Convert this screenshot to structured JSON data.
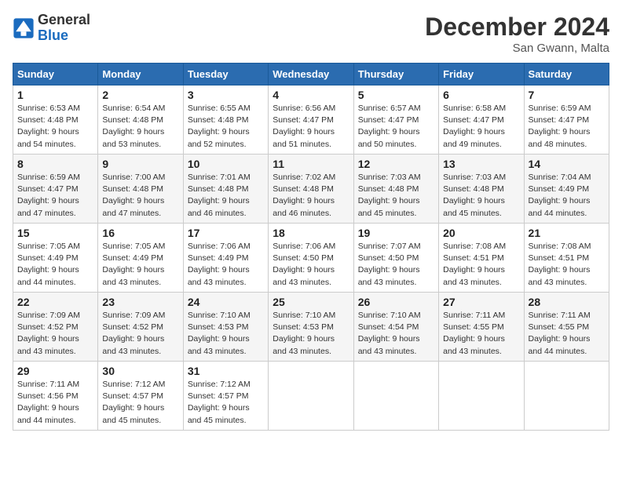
{
  "header": {
    "logo_general": "General",
    "logo_blue": "Blue",
    "month_title": "December 2024",
    "location": "San Gwann, Malta"
  },
  "weekdays": [
    "Sunday",
    "Monday",
    "Tuesday",
    "Wednesday",
    "Thursday",
    "Friday",
    "Saturday"
  ],
  "weeks": [
    [
      {
        "day": 1,
        "sunrise": "6:53 AM",
        "sunset": "4:48 PM",
        "daylight": "9 hours and 54 minutes."
      },
      {
        "day": 2,
        "sunrise": "6:54 AM",
        "sunset": "4:48 PM",
        "daylight": "9 hours and 53 minutes."
      },
      {
        "day": 3,
        "sunrise": "6:55 AM",
        "sunset": "4:48 PM",
        "daylight": "9 hours and 52 minutes."
      },
      {
        "day": 4,
        "sunrise": "6:56 AM",
        "sunset": "4:47 PM",
        "daylight": "9 hours and 51 minutes."
      },
      {
        "day": 5,
        "sunrise": "6:57 AM",
        "sunset": "4:47 PM",
        "daylight": "9 hours and 50 minutes."
      },
      {
        "day": 6,
        "sunrise": "6:58 AM",
        "sunset": "4:47 PM",
        "daylight": "9 hours and 49 minutes."
      },
      {
        "day": 7,
        "sunrise": "6:59 AM",
        "sunset": "4:47 PM",
        "daylight": "9 hours and 48 minutes."
      }
    ],
    [
      {
        "day": 8,
        "sunrise": "6:59 AM",
        "sunset": "4:47 PM",
        "daylight": "9 hours and 47 minutes."
      },
      {
        "day": 9,
        "sunrise": "7:00 AM",
        "sunset": "4:48 PM",
        "daylight": "9 hours and 47 minutes."
      },
      {
        "day": 10,
        "sunrise": "7:01 AM",
        "sunset": "4:48 PM",
        "daylight": "9 hours and 46 minutes."
      },
      {
        "day": 11,
        "sunrise": "7:02 AM",
        "sunset": "4:48 PM",
        "daylight": "9 hours and 46 minutes."
      },
      {
        "day": 12,
        "sunrise": "7:03 AM",
        "sunset": "4:48 PM",
        "daylight": "9 hours and 45 minutes."
      },
      {
        "day": 13,
        "sunrise": "7:03 AM",
        "sunset": "4:48 PM",
        "daylight": "9 hours and 45 minutes."
      },
      {
        "day": 14,
        "sunrise": "7:04 AM",
        "sunset": "4:49 PM",
        "daylight": "9 hours and 44 minutes."
      }
    ],
    [
      {
        "day": 15,
        "sunrise": "7:05 AM",
        "sunset": "4:49 PM",
        "daylight": "9 hours and 44 minutes."
      },
      {
        "day": 16,
        "sunrise": "7:05 AM",
        "sunset": "4:49 PM",
        "daylight": "9 hours and 43 minutes."
      },
      {
        "day": 17,
        "sunrise": "7:06 AM",
        "sunset": "4:49 PM",
        "daylight": "9 hours and 43 minutes."
      },
      {
        "day": 18,
        "sunrise": "7:06 AM",
        "sunset": "4:50 PM",
        "daylight": "9 hours and 43 minutes."
      },
      {
        "day": 19,
        "sunrise": "7:07 AM",
        "sunset": "4:50 PM",
        "daylight": "9 hours and 43 minutes."
      },
      {
        "day": 20,
        "sunrise": "7:08 AM",
        "sunset": "4:51 PM",
        "daylight": "9 hours and 43 minutes."
      },
      {
        "day": 21,
        "sunrise": "7:08 AM",
        "sunset": "4:51 PM",
        "daylight": "9 hours and 43 minutes."
      }
    ],
    [
      {
        "day": 22,
        "sunrise": "7:09 AM",
        "sunset": "4:52 PM",
        "daylight": "9 hours and 43 minutes."
      },
      {
        "day": 23,
        "sunrise": "7:09 AM",
        "sunset": "4:52 PM",
        "daylight": "9 hours and 43 minutes."
      },
      {
        "day": 24,
        "sunrise": "7:10 AM",
        "sunset": "4:53 PM",
        "daylight": "9 hours and 43 minutes."
      },
      {
        "day": 25,
        "sunrise": "7:10 AM",
        "sunset": "4:53 PM",
        "daylight": "9 hours and 43 minutes."
      },
      {
        "day": 26,
        "sunrise": "7:10 AM",
        "sunset": "4:54 PM",
        "daylight": "9 hours and 43 minutes."
      },
      {
        "day": 27,
        "sunrise": "7:11 AM",
        "sunset": "4:55 PM",
        "daylight": "9 hours and 43 minutes."
      },
      {
        "day": 28,
        "sunrise": "7:11 AM",
        "sunset": "4:55 PM",
        "daylight": "9 hours and 44 minutes."
      }
    ],
    [
      {
        "day": 29,
        "sunrise": "7:11 AM",
        "sunset": "4:56 PM",
        "daylight": "9 hours and 44 minutes."
      },
      {
        "day": 30,
        "sunrise": "7:12 AM",
        "sunset": "4:57 PM",
        "daylight": "9 hours and 45 minutes."
      },
      {
        "day": 31,
        "sunrise": "7:12 AM",
        "sunset": "4:57 PM",
        "daylight": "9 hours and 45 minutes."
      },
      null,
      null,
      null,
      null
    ]
  ],
  "labels": {
    "sunrise": "Sunrise:",
    "sunset": "Sunset:",
    "daylight": "Daylight:"
  }
}
